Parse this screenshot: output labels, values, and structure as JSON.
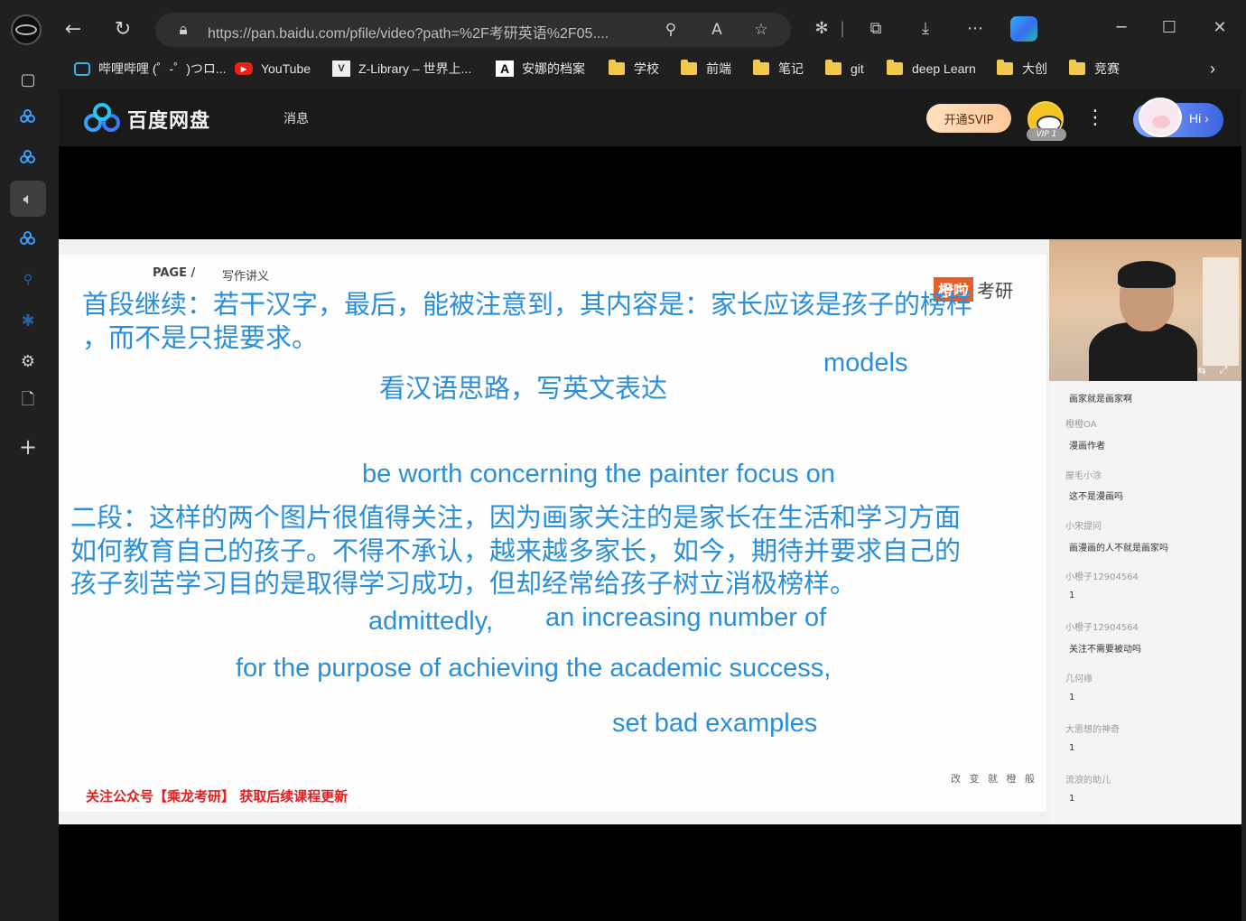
{
  "browser": {
    "url": "https://pan.baidu.com/pfile/video?path=%2F考研英语%2F05....",
    "bookmarks": [
      {
        "label": "哔哩哔哩 (゜-゜)つロ...",
        "icon": "bilibili-icon"
      },
      {
        "label": "YouTube",
        "icon": "youtube-icon"
      },
      {
        "label": "Z-Library – 世界上...",
        "icon": "zlibrary-icon"
      },
      {
        "label": "安娜的档案",
        "icon": "annas-archive-icon"
      },
      {
        "label": "学校",
        "icon": "folder-icon"
      },
      {
        "label": "前端",
        "icon": "folder-icon"
      },
      {
        "label": "笔记",
        "icon": "folder-icon"
      },
      {
        "label": "git",
        "icon": "folder-icon"
      },
      {
        "label": "deep Learn",
        "icon": "folder-icon"
      },
      {
        "label": "大创",
        "icon": "folder-icon"
      },
      {
        "label": "竞赛",
        "icon": "folder-icon"
      }
    ]
  },
  "header": {
    "logo_text": "百度网盘",
    "nav_message": "消息",
    "svip_label": "开通SVIP",
    "vip_badge": "VIP 1",
    "hi_label": "Hi ›"
  },
  "slide": {
    "page_label": "PAGE /",
    "lecture_label": "写作讲义",
    "brand_tag": "橙啦",
    "brand_word": "考研",
    "para1_line1": "首段继续：若干汉字，最后，能被注意到，其内容是：家长应该是孩子的榜样",
    "para1_line2": "，而不是只提要求。",
    "hint": "看汉语思路，写英文表达",
    "en_models": "models",
    "en_phrases": "be worth concerning  the painter  focus on",
    "para2_line1": "二段：这样的两个图片很值得关注，因为画家关注的是家长在生活和学习方面",
    "para2_line2": "如何教育自己的孩子。不得不承认，越来越多家长，如今，期待并要求自己的",
    "para2_line3": "孩子刻苦学习目的是取得学习成功，但却经常给孩子树立消极榜样。",
    "en_admittedly": "admittedly,",
    "en_increasing": "an increasing number of",
    "en_purpose": "for the purpose of achieving the academic success,",
    "en_bad": "set bad examples",
    "footer_red": "关注公众号【乘龙考研】 获取后续课程更新",
    "footer_gray": "改 变 就 橙 般"
  },
  "chat": [
    {
      "type": "msg",
      "text": "画家就是画家啊"
    },
    {
      "type": "name",
      "text": "橙橙OA"
    },
    {
      "type": "msg",
      "text": "漫画作者"
    },
    {
      "type": "name",
      "text": "屋毛小涂"
    },
    {
      "type": "msg",
      "text": "这不是漫画吗"
    },
    {
      "type": "name",
      "text": "小宋提问"
    },
    {
      "type": "msg",
      "text": "画漫画的人不就是画家吗"
    },
    {
      "type": "name",
      "text": "小橙子12904564"
    },
    {
      "type": "msg",
      "text": "1"
    },
    {
      "type": "name",
      "text": "小橙子12904564"
    },
    {
      "type": "msg",
      "text": "关注不需要被动吗"
    },
    {
      "type": "name",
      "text": "几何缘"
    },
    {
      "type": "msg",
      "text": "1"
    },
    {
      "type": "name",
      "text": "大思想的神奇"
    },
    {
      "type": "msg",
      "text": "1"
    },
    {
      "type": "name",
      "text": "流浪的助儿"
    },
    {
      "type": "msg",
      "text": "1"
    }
  ]
}
